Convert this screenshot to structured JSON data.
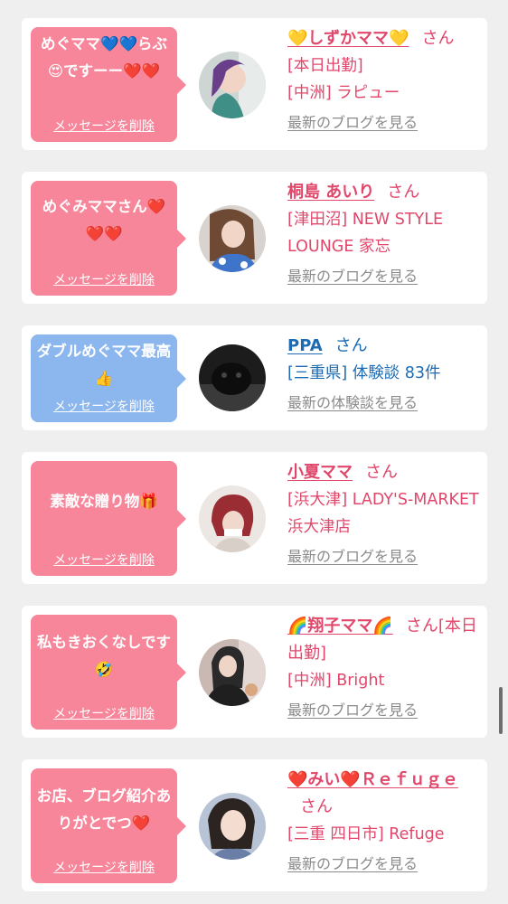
{
  "cards": [
    {
      "message": "めぐママ💙💙らぶ😍ですーー❤️❤️",
      "delete_label": "メッセージを削除",
      "name": "💛しずかママ💛",
      "suffix": "さん",
      "meta1": "[本日出勤]",
      "meta2": "[中洲] ラピュー",
      "link": "最新のブログを見る",
      "bubble_color": "#f7869a"
    },
    {
      "message": "めぐみママさん❤️❤️❤️",
      "delete_label": "メッセージを削除",
      "name": "桐島 あいり",
      "suffix": "さん",
      "meta1": "[津田沼] NEW STYLE LOUNGE 家忘",
      "link": "最新のブログを見る",
      "bubble_color": "#f7869a"
    },
    {
      "message": "ダブルめぐママ最高👍",
      "delete_label": "メッセージを削除",
      "name": "PPA",
      "suffix": "さん",
      "meta1": "[三重県] 体験談 83件",
      "link": "最新の体験談を見る",
      "bubble_color": "#8bb6ee"
    },
    {
      "message": "素敵な贈り物🎁",
      "delete_label": "メッセージを削除",
      "name": "小夏ママ",
      "suffix": "さん",
      "meta1": "[浜大津] LADY'S-MARKET 浜大津店",
      "link": "最新のブログを見る",
      "bubble_color": "#f7869a"
    },
    {
      "message": "私もきおくなしです🤣",
      "delete_label": "メッセージを削除",
      "name": "🌈翔子ママ🌈",
      "suffix": "さん[本日出勤]",
      "meta1": "[中洲] Bright",
      "link": "最新のブログを見る",
      "bubble_color": "#f7869a"
    },
    {
      "message": "お店、ブログ紹介ありがとでつ❤️",
      "delete_label": "メッセージを削除",
      "name": "❤️みい❤️Ｒｅｆｕｇｅ",
      "suffix": "さん",
      "meta1": "[三重 四日市] Refuge",
      "link": "最新のブログを見る",
      "bubble_color": "#f7869a"
    }
  ]
}
